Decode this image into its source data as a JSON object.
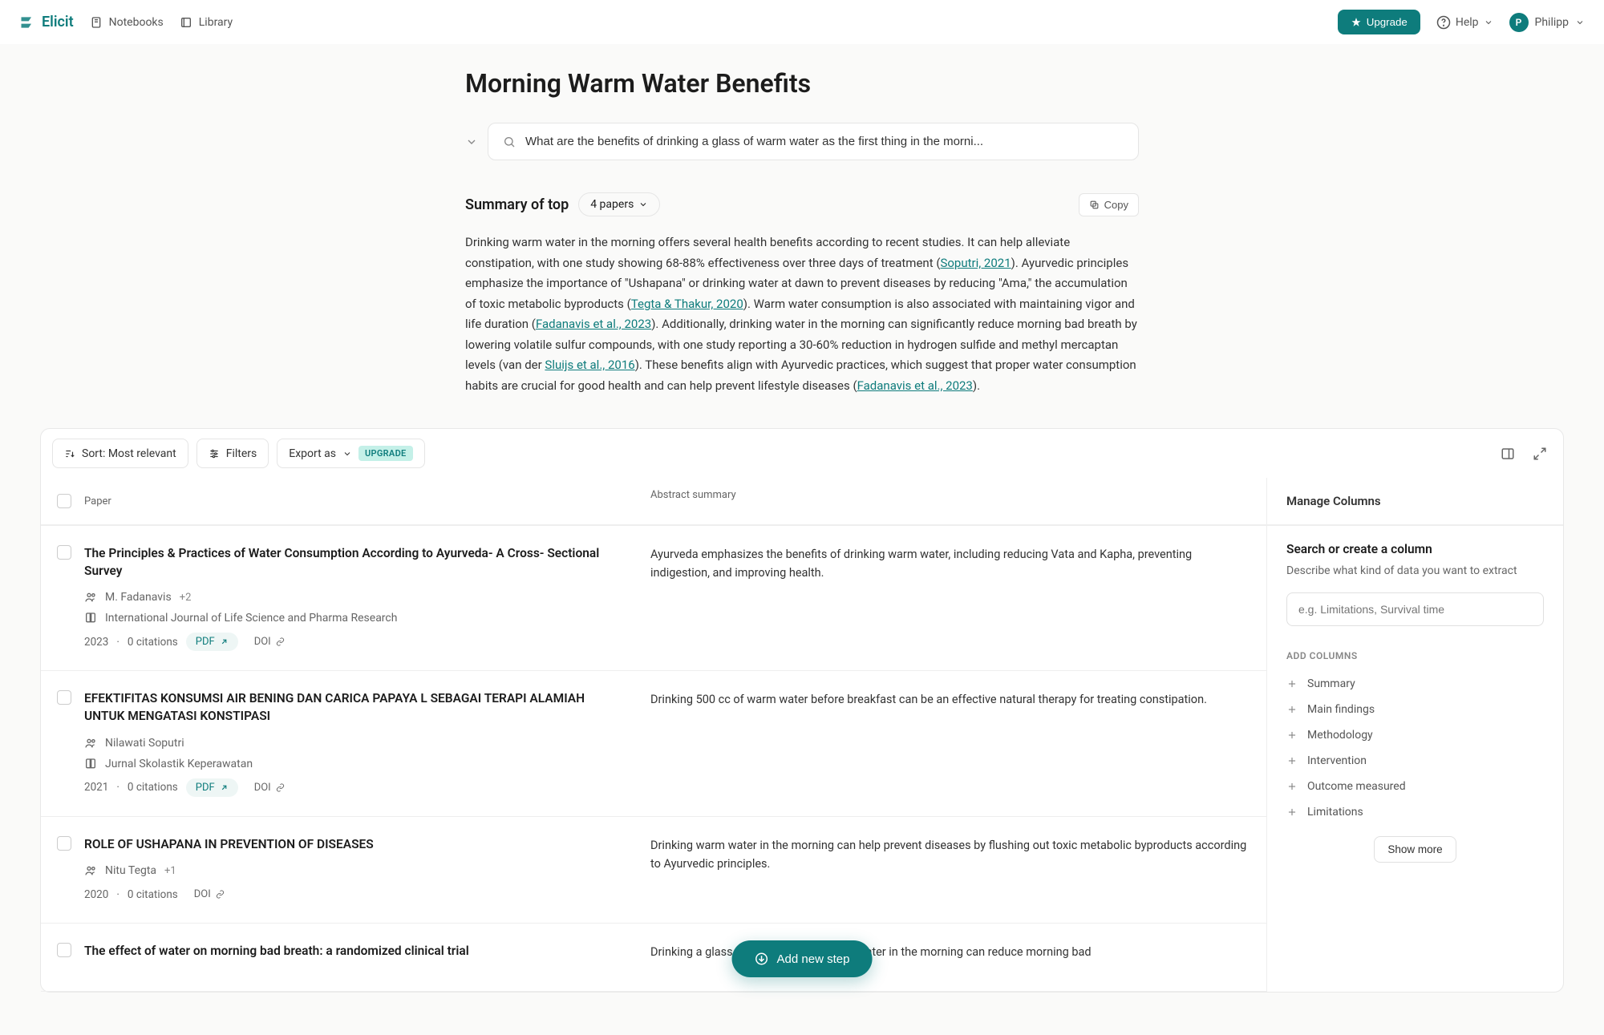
{
  "nav": {
    "brand": "Elicit",
    "notebooks": "Notebooks",
    "library": "Library",
    "upgrade": "Upgrade",
    "help": "Help",
    "user": "Philipp",
    "userInitial": "P"
  },
  "page": {
    "title": "Morning Warm Water Benefits",
    "query": "What are the benefits of drinking a glass of warm water as the first thing in the morni..."
  },
  "summary": {
    "title": "Summary of top",
    "paperCount": "4 papers",
    "copy": "Copy",
    "body": {
      "p1": "Drinking warm water in the morning offers several health benefits according to recent studies. It can help alleviate constipation, with one study showing 68-88% effectiveness over three days of treatment (",
      "c1": "Soputri, 2021",
      "p2": "). Ayurvedic principles emphasize the importance of \"Ushapana\" or drinking water at dawn to prevent diseases by reducing \"Ama,\" the accumulation of toxic metabolic byproducts (",
      "c2": "Tegta & Thakur, 2020",
      "p3": "). Warm water consumption is also associated with maintaining vigor and life duration (",
      "c3": "Fadanavis et al., 2023",
      "p4": "). Additionally, drinking water in the morning can significantly reduce morning bad breath by lowering volatile sulfur compounds, with one study reporting a 30-60% reduction in hydrogen sulfide and methyl mercaptan levels (van der ",
      "c4": "Sluijs et al., 2016",
      "p5": "). These benefits align with Ayurvedic practices, which suggest that proper water consumption habits are crucial for good health and can help prevent lifestyle diseases (",
      "c5": "Fadanavis et al., 2023",
      "p6": ")."
    }
  },
  "toolbar": {
    "sort": "Sort: Most relevant",
    "filters": "Filters",
    "export": "Export as",
    "upgradeBadge": "UPGRADE"
  },
  "columns": {
    "paper": "Paper",
    "abstract": "Abstract summary",
    "manage": "Manage Columns"
  },
  "papers": [
    {
      "title": "The Principles & Practices of Water Consumption According to Ayurveda- A Cross- Sectional Survey",
      "author": "M. Fadanavis",
      "authorExtra": "+2",
      "venue": "International Journal of Life Science and Pharma Research",
      "year": "2023",
      "citations": "0 citations",
      "hasPdf": true,
      "hasDoi": true,
      "abstract": "Ayurveda emphasizes the benefits of drinking warm water, including reducing Vata and Kapha, preventing indigestion, and improving health."
    },
    {
      "title": "EFEKTIFITAS KONSUMSI AIR BENING DAN CARICA PAPAYA L SEBAGAI TERAPI ALAMIAH UNTUK MENGATASI KONSTIPASI",
      "author": "Nilawati Soputri",
      "authorExtra": "",
      "venue": "Jurnal Skolastik Keperawatan",
      "year": "2021",
      "citations": "0 citations",
      "hasPdf": true,
      "hasDoi": true,
      "abstract": "Drinking 500 cc of warm water before breakfast can be an effective natural therapy for treating constipation."
    },
    {
      "title": "ROLE OF USHAPANA IN PREVENTION OF DISEASES",
      "author": "Nitu Tegta",
      "authorExtra": "+1",
      "venue": "",
      "year": "2020",
      "citations": "0 citations",
      "hasPdf": false,
      "hasDoi": true,
      "abstract": "Drinking warm water in the morning can help prevent diseases by flushing out toxic metabolic byproducts according to Ayurvedic principles."
    },
    {
      "title": "The effect of water on morning bad breath: a randomized clinical trial",
      "author": "",
      "authorExtra": "",
      "venue": "",
      "year": "",
      "citations": "",
      "hasPdf": false,
      "hasDoi": false,
      "abstract": "Drinking a glass of water or rinsing with water in the morning can reduce morning bad"
    }
  ],
  "labels": {
    "pdf": "PDF",
    "doi": "DOI",
    "sep": " · "
  },
  "side": {
    "search": "Search or create a column",
    "desc": "Describe what kind of data you want to extract",
    "placeholder": "e.g. Limitations, Survival time",
    "addColumns": "ADD COLUMNS",
    "items": [
      "Summary",
      "Main findings",
      "Methodology",
      "Intervention",
      "Outcome measured",
      "Limitations"
    ],
    "showMore": "Show more"
  },
  "addStep": "Add new step"
}
